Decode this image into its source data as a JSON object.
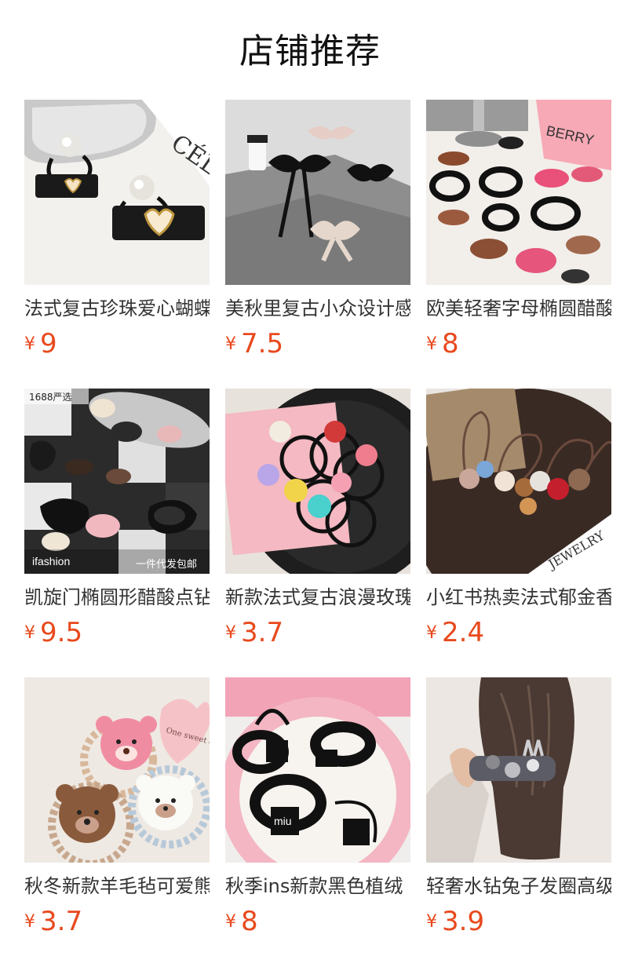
{
  "header": {
    "title": "店铺推荐"
  },
  "currency_symbol": "¥",
  "products": [
    {
      "title": "法式复古珍珠爱心蝴蝶结",
      "price": "9",
      "image_text": "CÉLI"
    },
    {
      "title": "美秋里复古小众设计感",
      "price": "7.5",
      "image_text": ""
    },
    {
      "title": "欧美轻奢字母椭圆醋酸",
      "price": "8",
      "image_text": "BERRY"
    },
    {
      "title": "凯旋门椭圆形醋酸点钻",
      "price": "9.5",
      "image_badges": {
        "top_left": "1688严选",
        "bottom_left": "ifashion",
        "bottom_right": "一件代发包邮"
      }
    },
    {
      "title": "新款法式复古浪漫玫瑰",
      "price": "3.7",
      "image_text": ""
    },
    {
      "title": "小红书热卖法式郁金香",
      "price": "2.4",
      "image_text": "JEWELRY"
    },
    {
      "title": "秋冬新款羊毛毡可爱熊",
      "price": "3.7",
      "image_text": "One sweet day"
    },
    {
      "title": "秋季ins新款黑色植绒",
      "price": "8",
      "image_text": "miu"
    },
    {
      "title": "轻奢水钻兔子发圈高级",
      "price": "3.9",
      "image_text": ""
    }
  ],
  "colors": {
    "price": "#e8491d",
    "title_text": "#333333"
  }
}
